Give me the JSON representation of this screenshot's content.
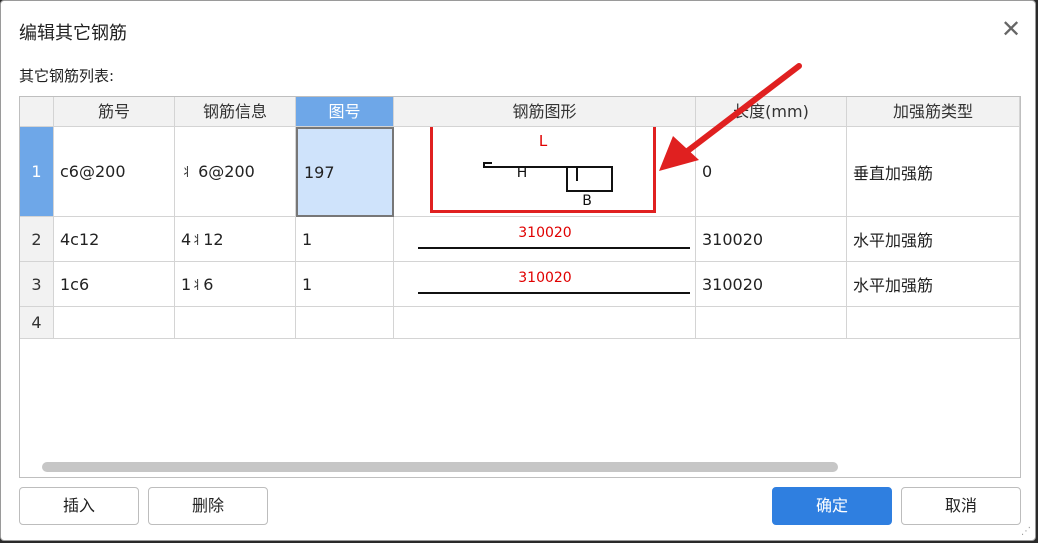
{
  "dialog": {
    "title": "编辑其它钢筋",
    "close_icon": "close-icon",
    "list_label": "其它钢筋列表:"
  },
  "table": {
    "columns": [
      "筋号",
      "钢筋信息",
      "图号",
      "钢筋图形",
      "长度(mm)",
      "加强筋类型"
    ],
    "rows": [
      {
        "num": "1",
        "jinhao": "c6@200",
        "info": " 6@200",
        "info_symbol": "丬",
        "tuhao": "197",
        "shape_labels": {
          "L": "L",
          "H": "H",
          "B": "B"
        },
        "length": "0",
        "type": "垂直加强筋"
      },
      {
        "num": "2",
        "jinhao": "4c12",
        "info_prefix": "4",
        "info_symbol": "丬",
        "info": "12",
        "tuhao": "1",
        "shape_value": "310020",
        "length": "310020",
        "type": "水平加强筋"
      },
      {
        "num": "3",
        "jinhao": "1c6",
        "info_prefix": "1",
        "info_symbol": "丬",
        "info": "6",
        "tuhao": "1",
        "shape_value": "310020",
        "length": "310020",
        "type": "水平加强筋"
      },
      {
        "num": "4",
        "jinhao": "",
        "info": "",
        "tuhao": "",
        "length": "",
        "type": ""
      }
    ]
  },
  "buttons": {
    "insert": "插入",
    "delete": "删除",
    "ok": "确定",
    "cancel": "取消"
  },
  "colors": {
    "accent": "#2f7fe0",
    "selected_header": "#6ea7e8",
    "annotation_red": "#e00000"
  }
}
